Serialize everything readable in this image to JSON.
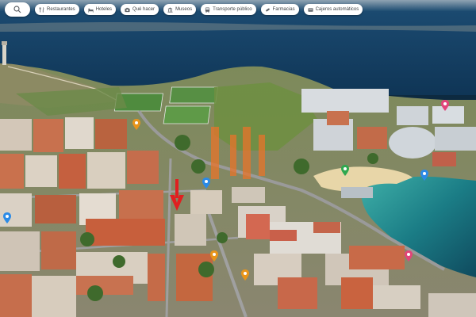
{
  "categories": [
    {
      "label": "Restaurantes",
      "icon": "fork-knife-icon"
    },
    {
      "label": "Hoteles",
      "icon": "bed-icon"
    },
    {
      "label": "Qué hacer",
      "icon": "camera-icon"
    },
    {
      "label": "Museos",
      "icon": "museum-icon"
    },
    {
      "label": "Transporte público",
      "icon": "bus-icon"
    },
    {
      "label": "Farmacias",
      "icon": "pill-icon"
    },
    {
      "label": "Cajeros automáticos",
      "icon": "atm-icon"
    }
  ],
  "search": {
    "icon": "search-icon"
  },
  "watermark": {
    "logo": "two-vertical-bars-logo",
    "color": "#e8742a"
  },
  "colors": {
    "sea": "#103a5c",
    "bay": "#1d8a92",
    "beach": "#e8d6a8",
    "grass": "#6e8a48",
    "rooftops": "#c8714e",
    "marker_red": "#e02020",
    "pin_orange": "#e8941a",
    "pin_blue": "#2b8ae6",
    "pin_pink": "#e2447a",
    "pin_green": "#2fa84f"
  },
  "marker": {
    "icon": "red-down-arrow-icon"
  }
}
